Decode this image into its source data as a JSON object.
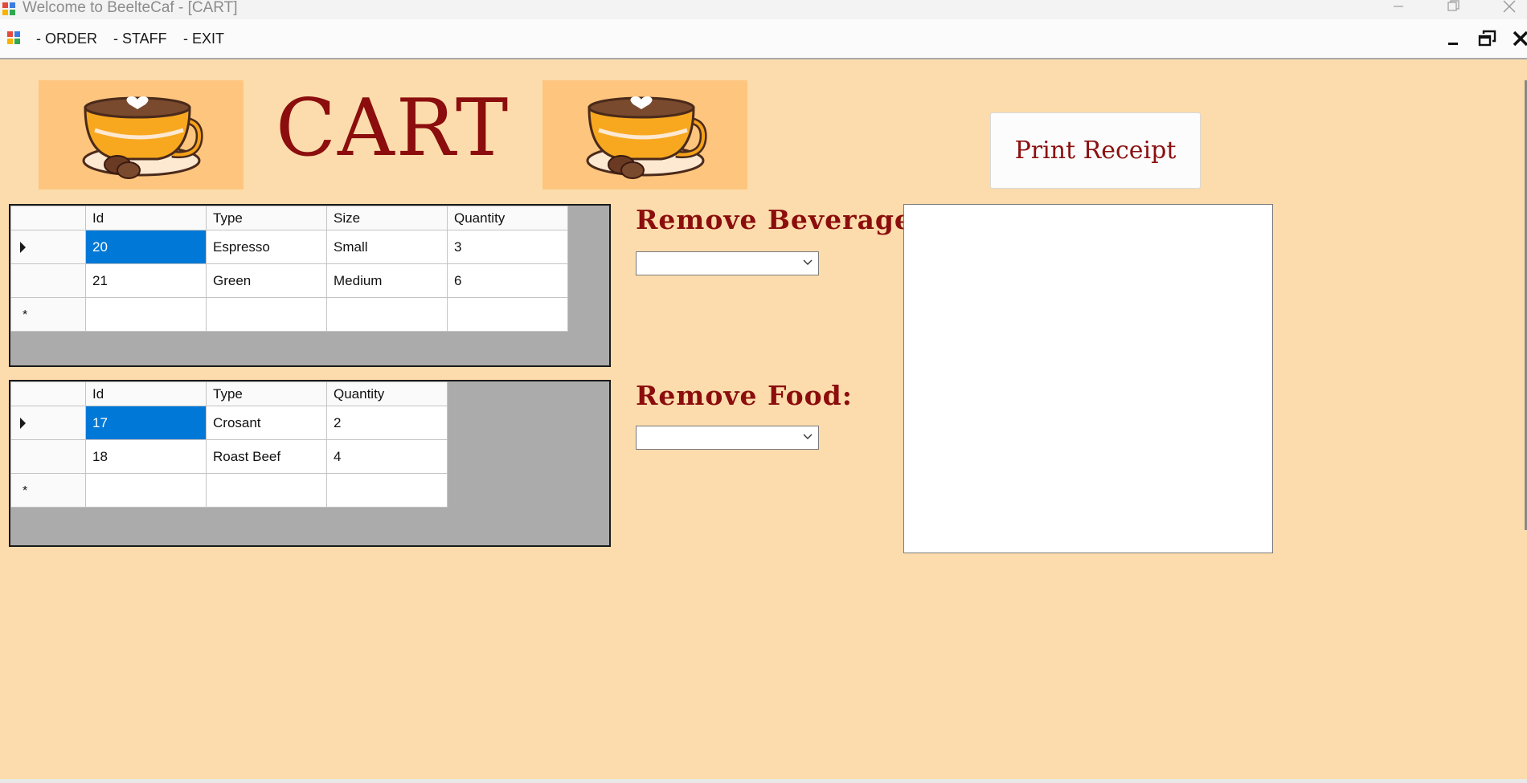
{
  "window": {
    "title": "Welcome to BeelteCaf - [CART]",
    "controls": [
      "minimize-icon",
      "restore-icon",
      "close-icon"
    ]
  },
  "menu": {
    "items": [
      "- ORDER",
      "- STAFF",
      "- EXIT"
    ],
    "mdi_controls": [
      "minimize-icon",
      "restore-icon",
      "close-icon"
    ]
  },
  "header": {
    "title": "CART",
    "print_button": "Print Receipt",
    "images": [
      "coffee-cup-icon",
      "coffee-cup-icon"
    ]
  },
  "beverage_grid": {
    "columns": [
      "Id",
      "Type",
      "Size",
      "Quantity"
    ],
    "rows": [
      [
        "20",
        "Espresso",
        "Small",
        "3"
      ],
      [
        "21",
        "Green",
        "Medium",
        "6"
      ]
    ],
    "selected_row": 0,
    "selected_cell": "Id"
  },
  "food_grid": {
    "columns": [
      "Id",
      "Type",
      "Quantity"
    ],
    "rows": [
      [
        "17",
        "Crosant",
        "2"
      ],
      [
        "18",
        "Roast Beef",
        "4"
      ]
    ],
    "selected_row": 0,
    "selected_cell": "Id"
  },
  "remove_beverage": {
    "label": "Remove Beverage:",
    "selected": ""
  },
  "remove_food": {
    "label": "Remove Food:",
    "selected": ""
  },
  "receipt": {
    "text": ""
  },
  "colors": {
    "background": "#fcdcac",
    "accent_text": "#8b0d0d",
    "selection": "#0078d7",
    "grid_background": "#ababab",
    "cup_panel": "#fdc57e"
  }
}
